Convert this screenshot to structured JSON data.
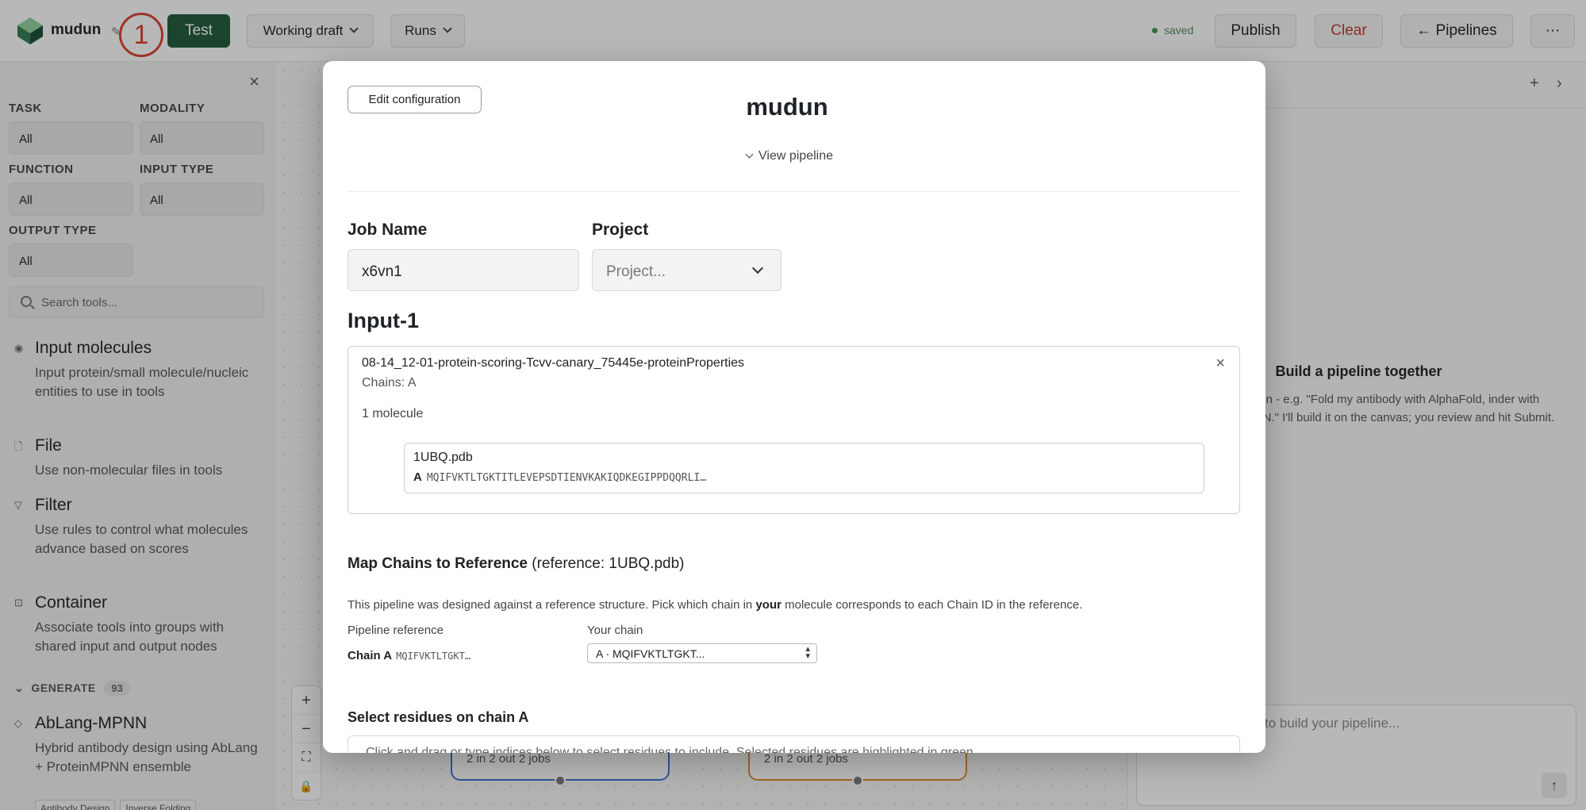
{
  "app": {
    "name": "mudun",
    "marker": "1",
    "test_label": "Test",
    "draft_label": "Working draft",
    "runs_label": "Runs",
    "saved_label": "saved",
    "publish_label": "Publish",
    "clear_label": "Clear",
    "pipelines_label": "← Pipelines",
    "more_label": "···"
  },
  "sidebar": {
    "filters": {
      "task": {
        "label": "TASK",
        "value": "All"
      },
      "modality": {
        "label": "MODALITY",
        "value": "All"
      },
      "function": {
        "label": "FUNCTION",
        "value": "All"
      },
      "input_type": {
        "label": "INPUT TYPE",
        "value": "All"
      },
      "output_type": {
        "label": "OUTPUT TYPE",
        "value": "All"
      }
    },
    "search_placeholder": "Search tools...",
    "tools": [
      {
        "icon": "circle-dot-icon",
        "name": "Input molecules",
        "desc": "Input protein/small molecule/nucleic entities to use in tools"
      },
      {
        "icon": "file-icon",
        "name": "File",
        "desc": "Use non-molecular files in tools"
      },
      {
        "icon": "filter-icon",
        "name": "Filter",
        "desc": "Use rules to control what molecules advance based on scores"
      },
      {
        "icon": "container-icon",
        "name": "Container",
        "desc": "Associate tools into groups with shared input and output nodes"
      }
    ],
    "section": {
      "label": "GENERATE",
      "count": "93"
    },
    "generate_tool": {
      "icon": "diamond-icon",
      "name": "AbLang-MPNN",
      "desc": "Hybrid antibody design using AbLang + ProteinMPNN ensemble",
      "tags": [
        "Antibody Design",
        "Inverse Folding"
      ]
    }
  },
  "canvas": {
    "zoom": {
      "in": "+",
      "out": "−",
      "fit": "⛶",
      "lock": "🔒"
    },
    "nodes": [
      {
        "ports": "2 in  2 out  2 jobs",
        "color": "#3b6fd4"
      },
      {
        "ports": "2 in  2 out  2 jobs",
        "color": "#d98a2b"
      }
    ]
  },
  "chat": {
    "title": "Build a pipeline together",
    "body": "want to run - e.g. \"Fold my antibody with AlphaFold, inder with ProteinMPNN.\" I'll build it on the canvas; you review and hit Submit.",
    "placeholder": "to build your pipeline..."
  },
  "modal": {
    "edit_label": "Edit configuration",
    "title": "mudun",
    "view_pipeline": "View pipeline",
    "job_name_label": "Job Name",
    "job_name_value": "x6vn1",
    "project_label": "Project",
    "project_placeholder": "Project...",
    "input_heading": "Input-1",
    "input": {
      "name": "08-14_12-01-protein-scoring-Tcvv-canary_75445e-proteinProperties",
      "chains": "Chains: A",
      "count": "1 molecule",
      "molecule": {
        "file": "1UBQ.pdb",
        "chain": "A",
        "sequence": "MQIFVKTLTGKTITLEVEPSDTIENVKAKIQDKEGIPPDQQRLI…"
      }
    },
    "map": {
      "title": "Map Chains to Reference",
      "reference": "(reference: 1UBQ.pdb)",
      "desc_before": "This pipeline was designed against a reference structure. Pick which chain in ",
      "desc_bold": "your",
      "desc_after": " molecule corresponds to each Chain ID in the reference.",
      "col_ref": "Pipeline reference",
      "col_yours": "Your chain",
      "chain_label": "Chain A",
      "chain_seq": "MQIFVKTLTGKT…",
      "chain_select": "A · MQIFVKTLTGKT..."
    },
    "residues": {
      "title": "Select residues on chain A",
      "hint": "Click and drag or type indices below to select residues to include. Selected residues are highlighted in green."
    }
  }
}
